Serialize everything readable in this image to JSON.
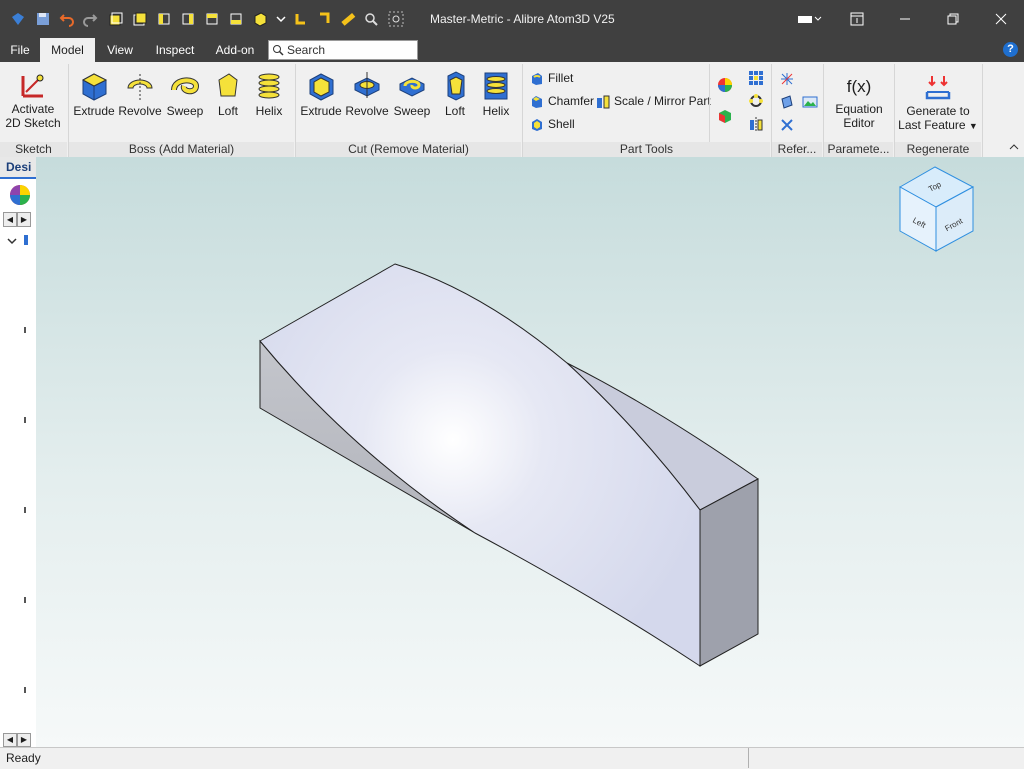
{
  "window": {
    "title": "Master-Metric - Alibre Atom3D V25"
  },
  "menu": {
    "tabs": [
      "File",
      "Model",
      "View",
      "Inspect",
      "Add-on"
    ],
    "active": "Model"
  },
  "search": {
    "placeholder": "Search"
  },
  "help": {
    "label": "?"
  },
  "ribbon": {
    "sketch": {
      "activate_label_1": "Activate",
      "activate_label_2": "2D Sketch",
      "group": "Sketch"
    },
    "boss": {
      "extrude": "Extrude",
      "revolve": "Revolve",
      "sweep": "Sweep",
      "loft": "Loft",
      "helix": "Helix",
      "group": "Boss (Add Material)"
    },
    "cut": {
      "extrude": "Extrude",
      "revolve": "Revolve",
      "sweep": "Sweep",
      "loft": "Loft",
      "helix": "Helix",
      "group": "Cut (Remove Material)"
    },
    "part_tools": {
      "fillet": "Fillet",
      "chamfer": "Chamfer",
      "scale_mirror": "Scale / Mirror Part",
      "shell": "Shell",
      "group": "Part Tools"
    },
    "reference": {
      "group": "Refer..."
    },
    "parameters": {
      "equation_icon": "f(x)",
      "equation_1": "Equation",
      "equation_2": "Editor",
      "group": "Paramete..."
    },
    "regenerate": {
      "label_1": "Generate to",
      "label_2": "Last Feature",
      "group": "Regenerate"
    }
  },
  "left_panel": {
    "tab_label": "Desi"
  },
  "view_cube": {
    "top": "Top",
    "left": "Left",
    "front": "Front"
  },
  "status": {
    "text": "Ready"
  },
  "colors": {
    "titlebar": "#404040",
    "accent_yellow": "#f5e13a",
    "accent_blue": "#2f6fd1"
  }
}
